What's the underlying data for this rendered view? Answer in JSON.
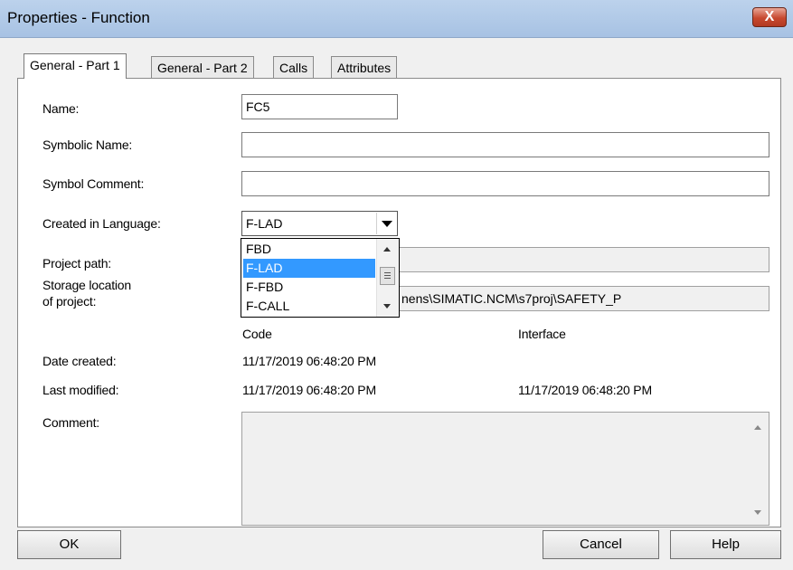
{
  "window": {
    "title": "Properties - Function",
    "close_glyph": "X"
  },
  "tabs": [
    {
      "label": "General - Part 1",
      "active": true
    },
    {
      "label": "General - Part 2",
      "active": false
    },
    {
      "label": "Calls",
      "active": false
    },
    {
      "label": "Attributes",
      "active": false
    }
  ],
  "form": {
    "name_label": "Name:",
    "name_value": "FC5",
    "symbolic_name_label": "Symbolic Name:",
    "symbolic_name_value": "",
    "symbol_comment_label": "Symbol Comment:",
    "symbol_comment_value": "",
    "language_label": "Created in Language:",
    "language_value": "F-LAD",
    "language_options": [
      "FBD",
      "F-LAD",
      "F-FBD",
      "F-CALL"
    ],
    "language_selected": "F-LAD",
    "project_path_label": "Project path:",
    "project_path_value": "",
    "storage_label_line1": "Storage location",
    "storage_label_line2": "of project:",
    "storage_value": "nens\\SIMATIC.NCM\\s7proj\\SAFETY_P",
    "code_header": "Code",
    "interface_header": "Interface",
    "date_created_label": "Date created:",
    "date_created_code": "11/17/2019 06:48:20 PM",
    "last_modified_label": "Last modified:",
    "last_modified_code": "11/17/2019 06:48:20 PM",
    "last_modified_interface": "11/17/2019 06:48:20 PM",
    "comment_label": "Comment:",
    "comment_value": ""
  },
  "buttons": {
    "ok": "OK",
    "cancel": "Cancel",
    "help": "Help"
  },
  "colors": {
    "selection": "#3399ff",
    "close_button": "#c7492f",
    "titlebar": "#bcd2ec"
  }
}
